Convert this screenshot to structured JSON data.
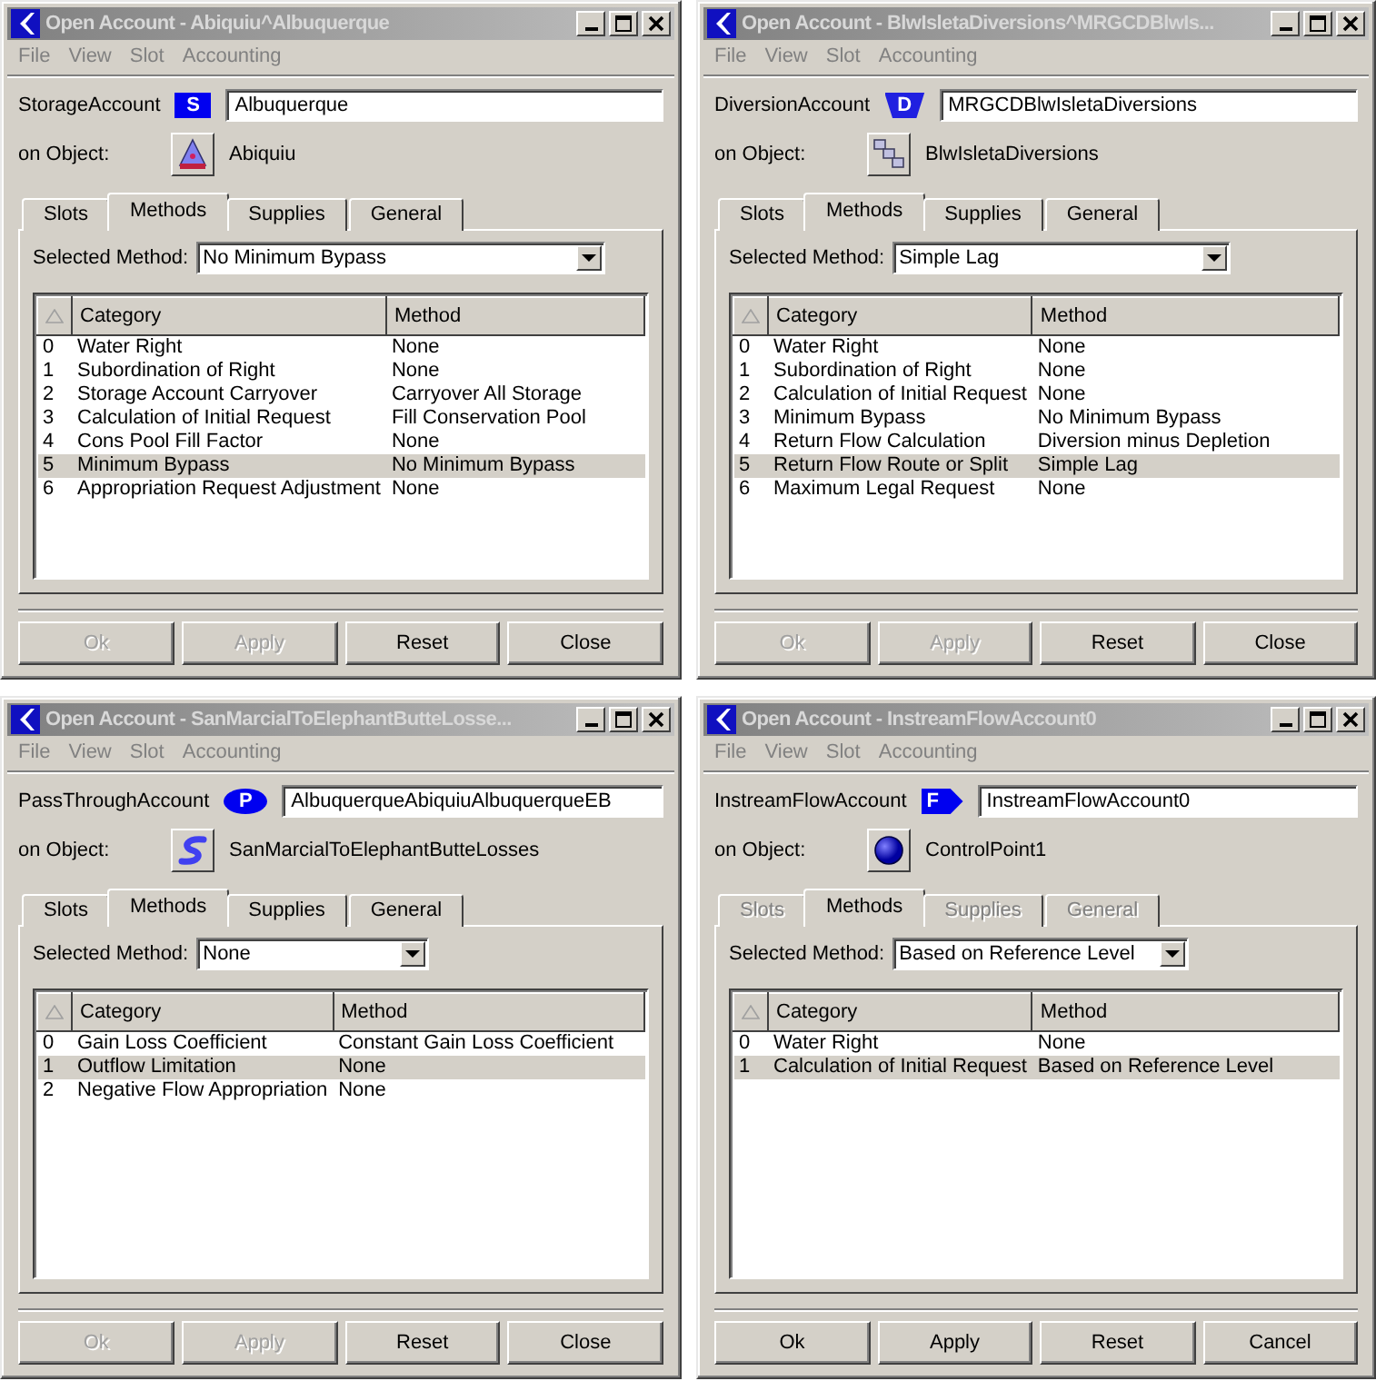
{
  "windows": [
    {
      "title": "Open Account - Abiquiu^Albuquerque",
      "menu": [
        "File",
        "View",
        "Slot",
        "Accounting"
      ],
      "account": {
        "type": "StorageAccount",
        "kind": "storage",
        "badge": "S",
        "name": "Albuquerque"
      },
      "object": {
        "label": "on Object:",
        "kind": "reservoir",
        "name": "Abiquiu"
      },
      "tabs": [
        {
          "label": "Slots",
          "selected": false,
          "disabled": false
        },
        {
          "label": "Methods",
          "selected": true,
          "disabled": false
        },
        {
          "label": "Supplies",
          "selected": false,
          "disabled": false
        },
        {
          "label": "General",
          "selected": false,
          "disabled": false
        }
      ],
      "selected_method": {
        "label": "Selected Method:",
        "value": "No Minimum Bypass"
      },
      "table": {
        "columns": [
          "Category",
          "Method"
        ],
        "rows": [
          {
            "index": "0",
            "category": "Water Right",
            "method": "None",
            "selected": false
          },
          {
            "index": "1",
            "category": "Subordination of Right",
            "method": "None",
            "selected": false
          },
          {
            "index": "2",
            "category": "Storage Account Carryover",
            "method": "Carryover All Storage",
            "selected": false
          },
          {
            "index": "3",
            "category": "Calculation of Initial Request",
            "method": "Fill Conservation Pool",
            "selected": false
          },
          {
            "index": "4",
            "category": "Cons Pool Fill Factor",
            "method": "None",
            "selected": false
          },
          {
            "index": "5",
            "category": "Minimum Bypass",
            "method": "No Minimum Bypass",
            "selected": true
          },
          {
            "index": "6",
            "category": "Appropriation Request Adjustment",
            "method": "None",
            "selected": false
          }
        ]
      },
      "buttons": [
        {
          "label": "Ok",
          "disabled": true
        },
        {
          "label": "Apply",
          "disabled": true
        },
        {
          "label": "Reset",
          "disabled": false
        },
        {
          "label": "Close",
          "disabled": false
        }
      ]
    },
    {
      "title": "Open Account - BlwIsletaDiversions^MRGCDBlwIs...",
      "menu": [
        "File",
        "View",
        "Slot",
        "Accounting"
      ],
      "account": {
        "type": "DiversionAccount",
        "kind": "diversion",
        "badge": "D",
        "name": "MRGCDBlwIsletaDiversions"
      },
      "object": {
        "label": "on Object:",
        "kind": "diversion",
        "name": "BlwIsletaDiversions"
      },
      "tabs": [
        {
          "label": "Slots",
          "selected": false,
          "disabled": false
        },
        {
          "label": "Methods",
          "selected": true,
          "disabled": false
        },
        {
          "label": "Supplies",
          "selected": false,
          "disabled": false
        },
        {
          "label": "General",
          "selected": false,
          "disabled": false
        }
      ],
      "selected_method": {
        "label": "Selected Method:",
        "value": "Simple Lag"
      },
      "table": {
        "columns": [
          "Category",
          "Method"
        ],
        "rows": [
          {
            "index": "0",
            "category": "Water Right",
            "method": "None",
            "selected": false
          },
          {
            "index": "1",
            "category": "Subordination of Right",
            "method": "None",
            "selected": false
          },
          {
            "index": "2",
            "category": "Calculation of Initial Request",
            "method": "None",
            "selected": false
          },
          {
            "index": "3",
            "category": "Minimum Bypass",
            "method": "No Minimum Bypass",
            "selected": false
          },
          {
            "index": "4",
            "category": "Return Flow Calculation",
            "method": "Diversion minus Depletion",
            "selected": false
          },
          {
            "index": "5",
            "category": "Return Flow Route or Split",
            "method": "Simple Lag",
            "selected": true
          },
          {
            "index": "6",
            "category": "Maximum Legal Request",
            "method": "None",
            "selected": false
          }
        ]
      },
      "buttons": [
        {
          "label": "Ok",
          "disabled": true
        },
        {
          "label": "Apply",
          "disabled": true
        },
        {
          "label": "Reset",
          "disabled": false
        },
        {
          "label": "Close",
          "disabled": false
        }
      ]
    },
    {
      "title": "Open Account - SanMarcialToElephantButteLosse...",
      "menu": [
        "File",
        "View",
        "Slot",
        "Accounting"
      ],
      "account": {
        "type": "PassThroughAccount",
        "kind": "passthrough",
        "badge": "P",
        "name": "AlbuquerqueAbiquiuAlbuquerqueEB"
      },
      "object": {
        "label": "on Object:",
        "kind": "reach",
        "name": "SanMarcialToElephantButteLosses"
      },
      "tabs": [
        {
          "label": "Slots",
          "selected": false,
          "disabled": false
        },
        {
          "label": "Methods",
          "selected": true,
          "disabled": false
        },
        {
          "label": "Supplies",
          "selected": false,
          "disabled": false
        },
        {
          "label": "General",
          "selected": false,
          "disabled": false
        }
      ],
      "selected_method": {
        "label": "Selected Method:",
        "value": "None"
      },
      "table": {
        "columns": [
          "Category",
          "Method"
        ],
        "rows": [
          {
            "index": "0",
            "category": "Gain Loss Coefficient",
            "method": "Constant Gain Loss Coefficient",
            "selected": false
          },
          {
            "index": "1",
            "category": "Outflow Limitation",
            "method": "None",
            "selected": true
          },
          {
            "index": "2",
            "category": "Negative Flow Appropriation",
            "method": "None",
            "selected": false
          }
        ]
      },
      "buttons": [
        {
          "label": "Ok",
          "disabled": true
        },
        {
          "label": "Apply",
          "disabled": true
        },
        {
          "label": "Reset",
          "disabled": false
        },
        {
          "label": "Close",
          "disabled": false
        }
      ]
    },
    {
      "title": "Open Account - InstreamFlowAccount0",
      "menu": [
        "File",
        "View",
        "Slot",
        "Accounting"
      ],
      "account": {
        "type": "InstreamFlowAccount",
        "kind": "instream",
        "badge": "F",
        "name": "InstreamFlowAccount0"
      },
      "object": {
        "label": "on Object:",
        "kind": "control_point",
        "name": "ControlPoint1"
      },
      "tabs": [
        {
          "label": "Slots",
          "selected": false,
          "disabled": true
        },
        {
          "label": "Methods",
          "selected": true,
          "disabled": false
        },
        {
          "label": "Supplies",
          "selected": false,
          "disabled": true
        },
        {
          "label": "General",
          "selected": false,
          "disabled": true
        }
      ],
      "selected_method": {
        "label": "Selected Method:",
        "value": "Based on Reference Level"
      },
      "table": {
        "columns": [
          "Category",
          "Method"
        ],
        "rows": [
          {
            "index": "0",
            "category": "Water Right",
            "method": "None",
            "selected": false
          },
          {
            "index": "1",
            "category": "Calculation of Initial Request",
            "method": "Based on Reference Level",
            "selected": true
          }
        ]
      },
      "buttons": [
        {
          "label": "Ok",
          "disabled": false
        },
        {
          "label": "Apply",
          "disabled": false
        },
        {
          "label": "Reset",
          "disabled": false
        },
        {
          "label": "Cancel",
          "disabled": false
        }
      ]
    }
  ]
}
